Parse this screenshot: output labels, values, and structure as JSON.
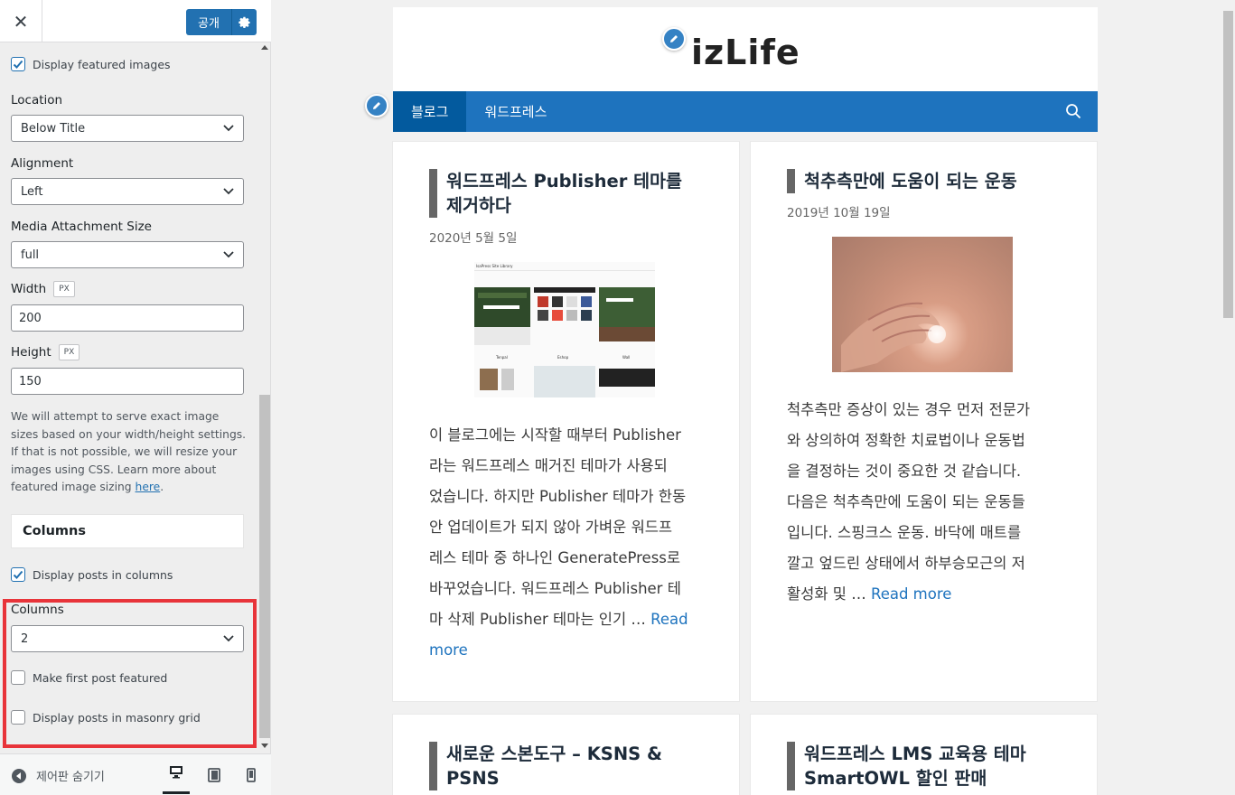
{
  "header": {
    "publish_label": "공개"
  },
  "sidebar": {
    "display_featured_images": "Display featured images",
    "location": {
      "label": "Location",
      "value": "Below Title"
    },
    "alignment": {
      "label": "Alignment",
      "value": "Left"
    },
    "media_size": {
      "label": "Media Attachment Size",
      "value": "full"
    },
    "width": {
      "label": "Width",
      "unit": "PX",
      "value": "200"
    },
    "height": {
      "label": "Height",
      "unit": "PX",
      "value": "150"
    },
    "help_text": "We will attempt to serve exact image sizes based on your width/height settings. If that is not possible, we will resize your images using CSS. Learn more about featured image sizing ",
    "help_link": "here",
    "help_end": ".",
    "columns_section": "Columns",
    "display_posts_in_columns": "Display posts in columns",
    "columns": {
      "label": "Columns",
      "value": "2"
    },
    "make_first_featured": "Make first post featured",
    "masonry": "Display posts in masonry grid",
    "hide_controls": "제어판 숨기기"
  },
  "site": {
    "logo": "izLife",
    "nav": [
      "블로그",
      "워드프레스"
    ]
  },
  "posts": [
    {
      "title": "워드프레스 Publisher 테마를 제거하다",
      "title_line1": "워드프레스 Publisher 테마를",
      "title_line2": "제거하다",
      "date": "2020년 5월 5일",
      "excerpt_lines": [
        "이 블로그에는 시작할 때부터 Publisher",
        "라는 워드프레스 매거진 테마가 사용되",
        "었습니다. 하지만 Publisher 테마가 한동",
        "안 업데이트가 되지 않아 가벼운 워드프",
        "레스 테마 중 하나인 GeneratePress로",
        "바꾸었습니다. 워드프레스 Publisher 테",
        "마 삭제 Publisher 테마는 인기 … "
      ],
      "read_more_1": "Read",
      "read_more_2": "more"
    },
    {
      "title": "척추측만에 도움이 되는 운동",
      "date": "2019년 10월 19일",
      "excerpt_lines": [
        "척추측만 증상이 있는 경우 먼저 전문가",
        "와 상의하여 정확한 치료법이나 운동법",
        "을 결정하는 것이 중요한 것 같습니다.",
        "다음은 척추측만에 도움이 되는 운동들",
        "입니다. 스핑크스 운동. 바닥에 매트를",
        "깔고 엎드린 상태에서 하부승모근의 저",
        "활성화 및 … "
      ],
      "read_more": "Read more"
    },
    {
      "title_line1": "새로운 스본도구 – KSNS &",
      "title_line2": "PSNS"
    },
    {
      "title_line1": "워드프레스 LMS 교육용 테마",
      "title_line2": "SmartOWL 할인 판매"
    }
  ],
  "thumb_text": {
    "site_title": "IsaPress Site Library",
    "label_a": "Tenpal",
    "label_b": "Eshop",
    "label_c": "Wall"
  },
  "colors": {
    "accent": "#2271b1",
    "nav": "#1e73be",
    "nav_active": "#035a9e",
    "highlight": "#e8343a"
  }
}
